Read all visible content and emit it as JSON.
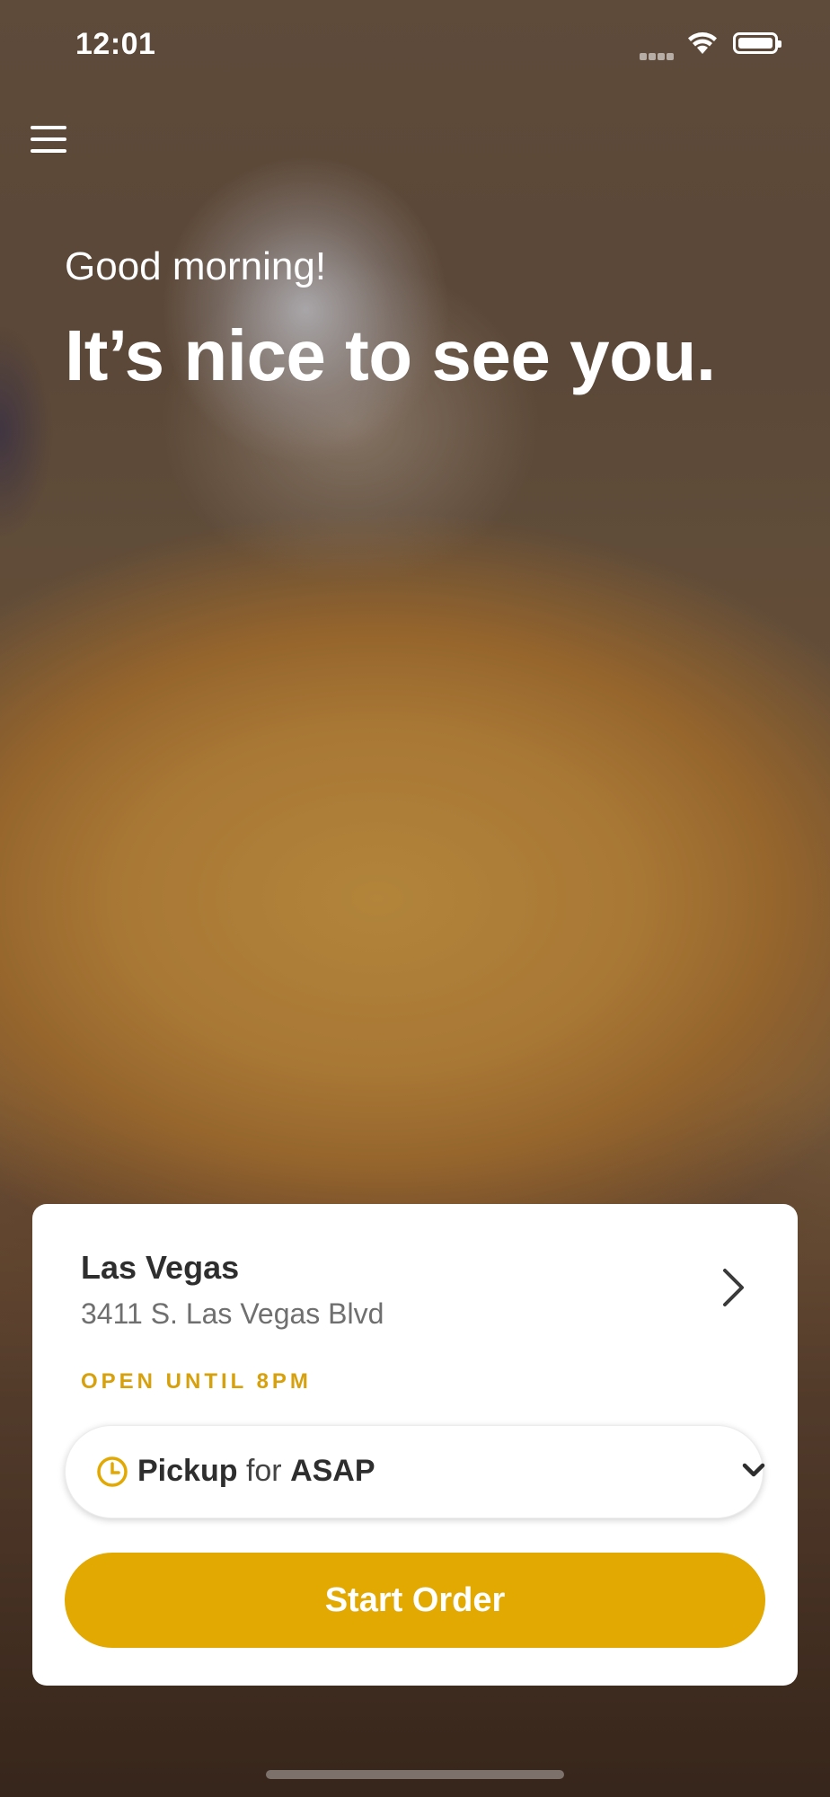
{
  "status_bar": {
    "time": "12:01",
    "signal_icon": "cellular-signal-icon",
    "wifi_icon": "wifi-icon",
    "battery_icon": "battery-icon"
  },
  "header": {
    "menu_icon": "hamburger-menu-icon",
    "greeting": "Good morning!",
    "headline": "It’s nice to see you."
  },
  "location_card": {
    "name": "Las Vegas",
    "address": "3411 S. Las Vegas Blvd",
    "open_status": "OPEN UNTIL 8PM",
    "chevron_icon": "chevron-right-icon"
  },
  "order_mode": {
    "mode": "Pickup",
    "connector": "for",
    "time": "ASAP",
    "clock_icon": "clock-icon",
    "dropdown_icon": "chevron-down-icon"
  },
  "actions": {
    "start_order_label": "Start Order"
  },
  "colors": {
    "accent": "#e2a903",
    "open_status": "#d6a10c",
    "text_dark": "#2e2e2e",
    "text_muted": "#6f6f6f",
    "card_background": "#ffffff"
  }
}
